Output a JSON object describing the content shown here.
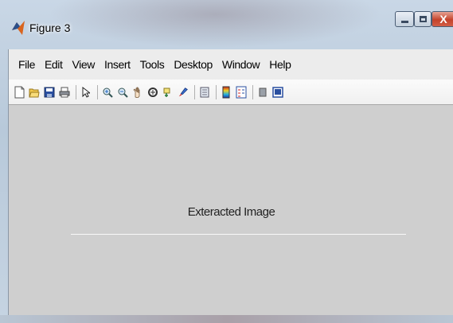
{
  "window": {
    "title": "Figure 3",
    "close_glyph": "X"
  },
  "menu": [
    "File",
    "Edit",
    "View",
    "Insert",
    "Tools",
    "Desktop",
    "Window",
    "Help"
  ],
  "toolbar_icons": [
    "new-figure-icon",
    "open-file-icon",
    "save-icon",
    "print-icon",
    "pointer-icon",
    "zoom-in-icon",
    "zoom-out-icon",
    "pan-icon",
    "rotate-3d-icon",
    "data-cursor-icon",
    "brush-icon",
    "link-plot-icon",
    "colorbar-icon",
    "legend-icon",
    "hide-plot-tools-icon",
    "show-plot-tools-icon"
  ],
  "axes": {
    "title": "Exteracted Image"
  },
  "colors": {
    "figure_background": "#cfcfcf",
    "close_button": "#c4422a"
  }
}
